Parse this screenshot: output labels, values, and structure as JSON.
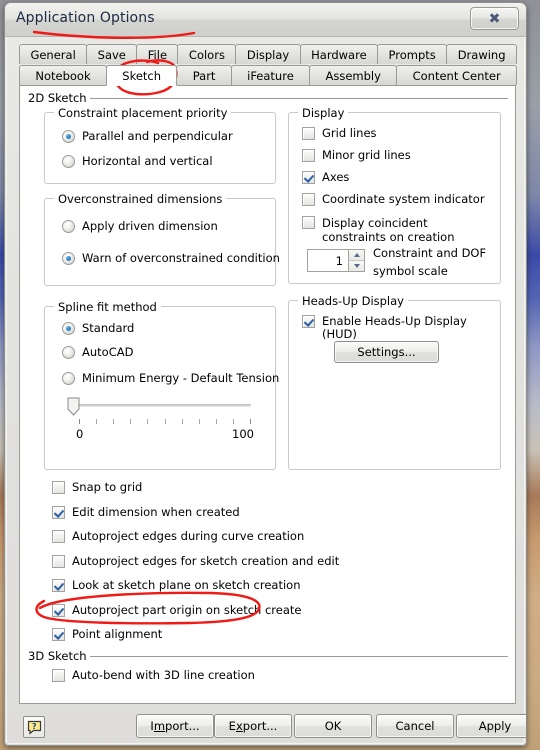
{
  "window": {
    "title": "Application Options",
    "close_label": "✖"
  },
  "tabs": {
    "row1": [
      {
        "label": "General",
        "active": false
      },
      {
        "label": "Save",
        "active": false
      },
      {
        "label": "File",
        "active": false
      },
      {
        "label": "Colors",
        "active": false
      },
      {
        "label": "Display",
        "active": false
      },
      {
        "label": "Hardware",
        "active": false
      },
      {
        "label": "Prompts",
        "active": false
      },
      {
        "label": "Drawing",
        "active": false
      }
    ],
    "row2": [
      {
        "label": "Notebook",
        "active": false
      },
      {
        "label": "Sketch",
        "active": true
      },
      {
        "label": "Part",
        "active": false
      },
      {
        "label": "iFeature",
        "active": false
      },
      {
        "label": "Assembly",
        "active": false
      },
      {
        "label": "Content Center",
        "active": false
      }
    ]
  },
  "sections": {
    "sketch_2d": "2D Sketch",
    "sketch_3d": "3D Sketch"
  },
  "constraint_priority": {
    "title": "Constraint placement priority",
    "options": [
      {
        "label": "Parallel and perpendicular",
        "checked": true
      },
      {
        "label": "Horizontal and vertical",
        "checked": false
      }
    ]
  },
  "overconstrained": {
    "title": "Overconstrained dimensions",
    "options": [
      {
        "label": "Apply driven dimension",
        "checked": false
      },
      {
        "label": "Warn of overconstrained condition",
        "checked": true
      }
    ]
  },
  "spline": {
    "title": "Spline fit method",
    "options": [
      {
        "label": "Standard",
        "checked": true
      },
      {
        "label": "AutoCAD",
        "checked": false
      },
      {
        "label": "Minimum Energy - Default Tension",
        "checked": false
      }
    ],
    "slider": {
      "min_label": "0",
      "max_label": "100",
      "value": 0,
      "tick_count": 11
    }
  },
  "display": {
    "title": "Display",
    "checkboxes": [
      {
        "label": "Grid lines",
        "checked": false
      },
      {
        "label": "Minor grid lines",
        "checked": false
      },
      {
        "label": "Axes",
        "checked": true
      },
      {
        "label": "Coordinate system indicator",
        "checked": false
      },
      {
        "label": "Display coincident constraints on creation",
        "checked": false
      }
    ],
    "scale_spinner": {
      "value": "1",
      "label_line1": "Constraint and DOF",
      "label_line2": "symbol scale"
    }
  },
  "hud": {
    "title": "Heads-Up Display",
    "enable": {
      "label": "Enable Heads-Up Display (HUD)",
      "checked": true
    },
    "settings_button": "Settings..."
  },
  "sketch_options": [
    {
      "label": "Snap to grid",
      "checked": false
    },
    {
      "label": "Edit dimension when created",
      "checked": true
    },
    {
      "label": "Autoproject edges during curve creation",
      "checked": false
    },
    {
      "label": "Autoproject edges for sketch creation and edit",
      "checked": false
    },
    {
      "label": "Look at sketch plane on sketch creation",
      "checked": true
    },
    {
      "label": "Autoproject part origin on sketch create",
      "checked": true
    },
    {
      "label": "Point alignment",
      "checked": true
    }
  ],
  "sketch_3d_options": [
    {
      "label": "Auto-bend with 3D line creation",
      "checked": false
    }
  ],
  "footer": {
    "help_icon": "help-balloon-icon",
    "buttons": [
      {
        "label": "Import...",
        "mnemonic_index": 1
      },
      {
        "label": "Export...",
        "mnemonic_index": 1
      },
      {
        "label": "OK",
        "mnemonic_index": -1
      },
      {
        "label": "Cancel",
        "mnemonic_index": -1
      },
      {
        "label": "Apply",
        "mnemonic_index": -1
      }
    ]
  },
  "annotations": {
    "color": "#ee1b17",
    "marks": [
      {
        "name": "underline-title",
        "shape": "underline"
      },
      {
        "name": "circle-sketch-tab",
        "shape": "ellipse"
      },
      {
        "name": "circle-autoproject-origin",
        "shape": "ellipse"
      }
    ]
  }
}
